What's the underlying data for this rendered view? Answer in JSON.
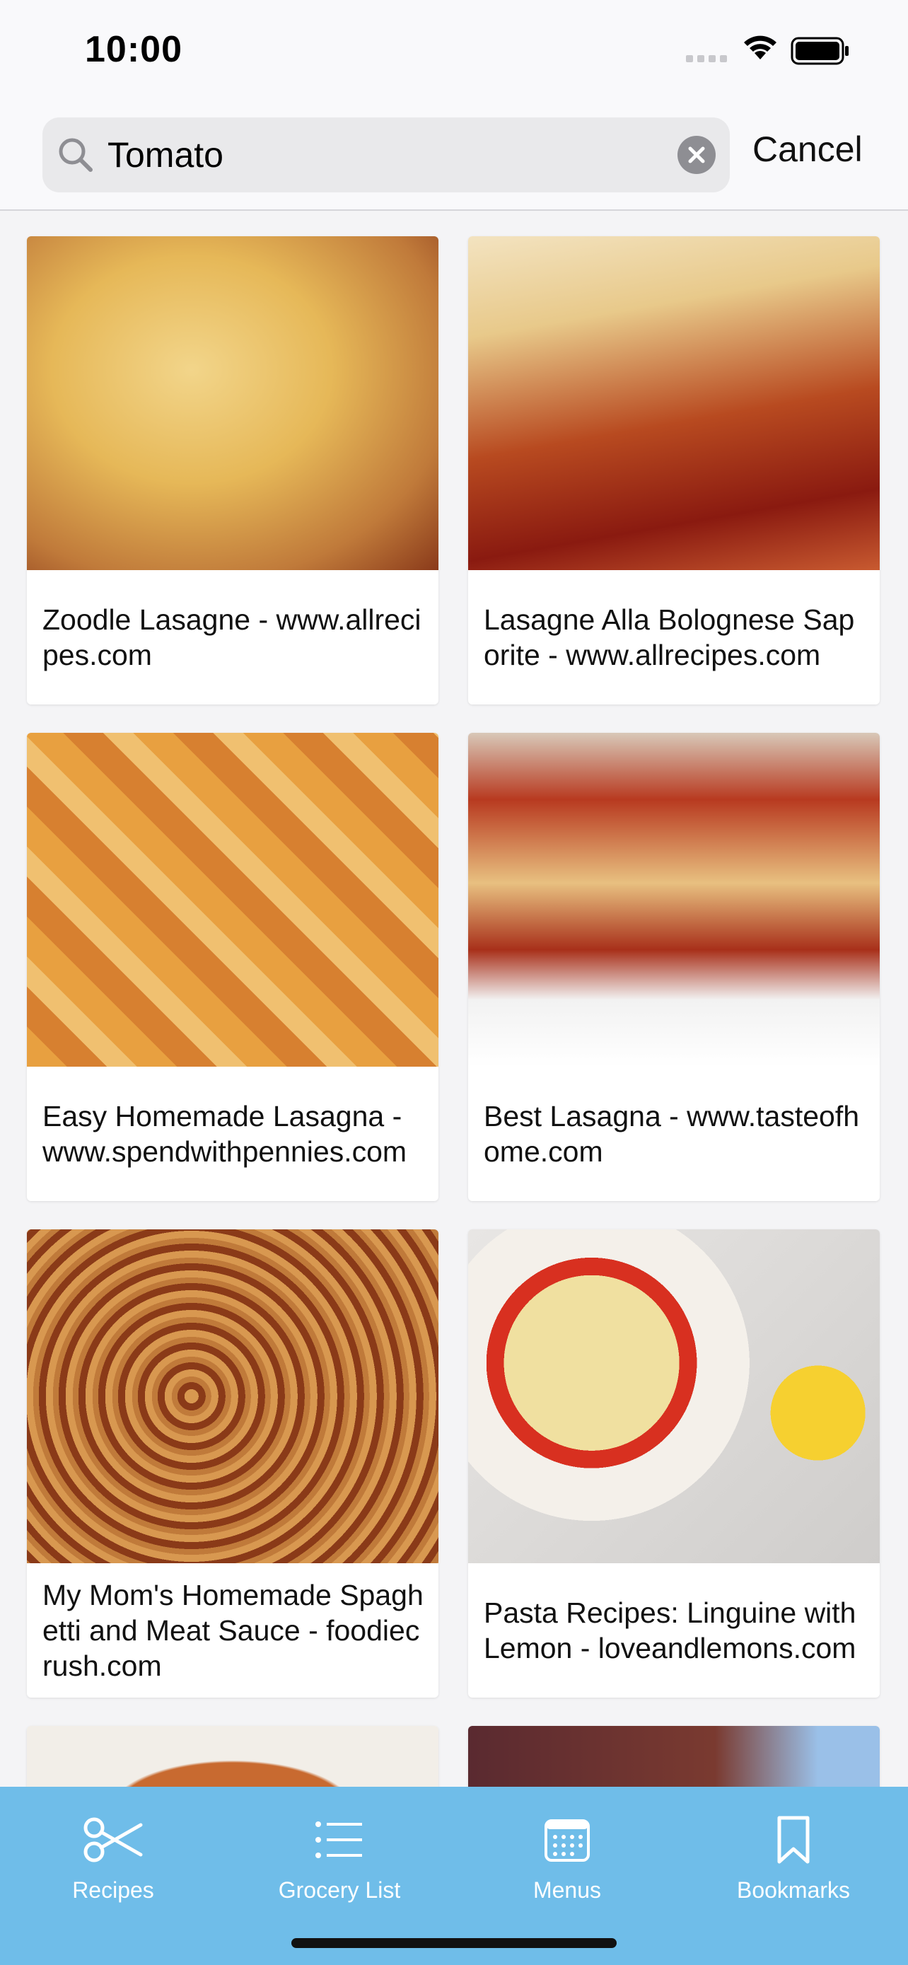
{
  "status": {
    "time": "10:00"
  },
  "search": {
    "value": "Tomato",
    "cancel_label": "Cancel"
  },
  "results": [
    {
      "caption": "Zoodle Lasagne - www.allrecipes.com"
    },
    {
      "caption": "Lasagne Alla Bolognese Saporite - www.allrecipes.com"
    },
    {
      "caption": "Easy Homemade Lasagna - www.spendwithpennies.com"
    },
    {
      "caption": "Best Lasagna - www.tasteofhome.com"
    },
    {
      "caption": "My Mom's Homemade Spaghetti and Meat Sauce - foodiecrush.com"
    },
    {
      "caption": "Pasta Recipes: Linguine with Lemon - loveandlemons.com"
    }
  ],
  "tabs": [
    {
      "label": "Recipes",
      "icon": "scissors-icon"
    },
    {
      "label": "Grocery List",
      "icon": "list-icon"
    },
    {
      "label": "Menus",
      "icon": "calendar-icon"
    },
    {
      "label": "Bookmarks",
      "icon": "bookmark-icon"
    }
  ],
  "colors": {
    "tabbar": "#6fbde9",
    "background": "#f4f4f6"
  }
}
